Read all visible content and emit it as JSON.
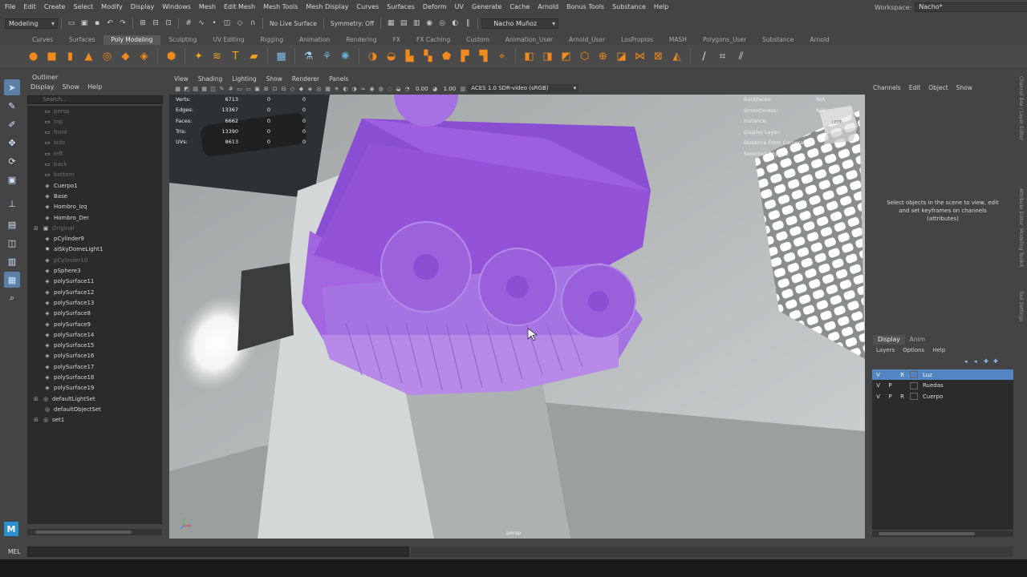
{
  "menubar": {
    "items": [
      "File",
      "Edit",
      "Create",
      "Select",
      "Modify",
      "Display",
      "Windows",
      "Mesh",
      "Edit Mesh",
      "Mesh Tools",
      "Mesh Display",
      "Curves",
      "Surfaces",
      "Deform",
      "UV",
      "Generate",
      "Cache",
      "Arnold",
      "Bonus Tools",
      "Substance",
      "Help"
    ],
    "workspace_label": "Workspace:",
    "workspace_value": "Nacho*"
  },
  "statusline": {
    "mode": "Modeling",
    "live_surface": "No Live Surface",
    "symmetry": "Symmetry: Off",
    "user": "Nacho Muñoz"
  },
  "shelf": {
    "tabs": [
      "Curves",
      "Surfaces",
      "Poly Modeling",
      "Sculpting",
      "UV Editing",
      "Rigging",
      "Animation",
      "Rendering",
      "FX",
      "FX Caching",
      "Custom",
      "Animation_User",
      "Arnold_User",
      "LosPropios",
      "MASH",
      "Polygons_User",
      "Substance",
      "Arnold"
    ],
    "active_tab": "Poly Modeling"
  },
  "outliner": {
    "title": "Outliner",
    "menu": [
      "Display",
      "Show",
      "Help"
    ],
    "search_placeholder": "Search...",
    "items": [
      {
        "label": "persp",
        "dim": true,
        "indent": 1,
        "icon": "camera"
      },
      {
        "label": "top",
        "dim": true,
        "indent": 1,
        "icon": "camera"
      },
      {
        "label": "front",
        "dim": true,
        "indent": 1,
        "icon": "camera"
      },
      {
        "label": "side",
        "dim": true,
        "indent": 1,
        "icon": "camera"
      },
      {
        "label": "left",
        "dim": true,
        "indent": 1,
        "icon": "camera"
      },
      {
        "label": "back",
        "dim": true,
        "indent": 1,
        "icon": "camera"
      },
      {
        "label": "bottom",
        "dim": true,
        "indent": 1,
        "icon": "camera"
      },
      {
        "label": "Cuerpo1",
        "dim": false,
        "indent": 1,
        "icon": "mesh"
      },
      {
        "label": "Base",
        "dim": false,
        "indent": 1,
        "icon": "mesh"
      },
      {
        "label": "Hombro_Izq",
        "dim": false,
        "indent": 1,
        "icon": "mesh"
      },
      {
        "label": "Hombro_Der",
        "dim": false,
        "indent": 1,
        "icon": "mesh"
      },
      {
        "label": "Original",
        "dim": true,
        "indent": 0,
        "icon": "group"
      },
      {
        "label": "pCylinder9",
        "dim": false,
        "indent": 1,
        "icon": "mesh"
      },
      {
        "label": "aiSkyDomeLight1",
        "dim": false,
        "indent": 1,
        "icon": "light"
      },
      {
        "label": "pCylinder10",
        "dim": true,
        "indent": 1,
        "icon": "mesh"
      },
      {
        "label": "pSphere3",
        "dim": false,
        "indent": 1,
        "icon": "mesh"
      },
      {
        "label": "polySurface11",
        "dim": false,
        "indent": 1,
        "icon": "mesh"
      },
      {
        "label": "polySurface12",
        "dim": false,
        "indent": 1,
        "icon": "mesh"
      },
      {
        "label": "polySurface13",
        "dim": false,
        "indent": 1,
        "icon": "mesh"
      },
      {
        "label": "polySurface8",
        "dim": false,
        "indent": 1,
        "icon": "mesh"
      },
      {
        "label": "polySurface9",
        "dim": false,
        "indent": 1,
        "icon": "mesh"
      },
      {
        "label": "polySurface14",
        "dim": false,
        "indent": 1,
        "icon": "mesh"
      },
      {
        "label": "polySurface15",
        "dim": false,
        "indent": 1,
        "icon": "mesh"
      },
      {
        "label": "polySurface16",
        "dim": false,
        "indent": 1,
        "icon": "mesh"
      },
      {
        "label": "polySurface17",
        "dim": false,
        "indent": 1,
        "icon": "mesh"
      },
      {
        "label": "polySurface18",
        "dim": false,
        "indent": 1,
        "icon": "mesh"
      },
      {
        "label": "polySurface19",
        "dim": false,
        "indent": 1,
        "icon": "mesh"
      },
      {
        "label": "defaultLightSet",
        "dim": false,
        "indent": 0,
        "icon": "set"
      },
      {
        "label": "defaultObjectSet",
        "dim": false,
        "indent": 1,
        "icon": "set"
      },
      {
        "label": "set1",
        "dim": false,
        "indent": 0,
        "icon": "set"
      }
    ]
  },
  "viewport": {
    "menus": [
      "View",
      "Shading",
      "Lighting",
      "Show",
      "Renderer",
      "Panels"
    ],
    "exposure": "0.00",
    "gamma": "1.00",
    "color_management": "ACES 1.0 SDR-video (sRGB)",
    "hud_left": [
      {
        "label": "Verts:",
        "v1": "6713",
        "v2": "0",
        "v3": "0"
      },
      {
        "label": "Edges:",
        "v1": "13367",
        "v2": "0",
        "v3": "0"
      },
      {
        "label": "Faces:",
        "v1": "6662",
        "v2": "0",
        "v3": "0"
      },
      {
        "label": "Tris:",
        "v1": "13390",
        "v2": "0",
        "v3": "0"
      },
      {
        "label": "UVs:",
        "v1": "8613",
        "v2": "0",
        "v3": "0"
      }
    ],
    "hud_right": [
      {
        "label": "Backfaces:",
        "value": "N/A"
      },
      {
        "label": "Smoothness:",
        "value": "N/A"
      },
      {
        "label": "Instance:",
        "value": ""
      },
      {
        "label": "Display Layer:",
        "value": ""
      },
      {
        "label": "Distance From Camera:",
        "value": ""
      },
      {
        "label": "Selected Objects:",
        "value": ""
      }
    ],
    "viewcube_label": "LEFT",
    "camera": "persp",
    "mesh_color": "#9a52d8"
  },
  "channel_box": {
    "menu": [
      "Channels",
      "Edit",
      "Object",
      "Show"
    ],
    "info": "Select objects in the scene to view, edit and set keyframes on channels (attributes)"
  },
  "layer_editor": {
    "tabs": [
      "Display",
      "Anim"
    ],
    "active_tab": "Display",
    "menu": [
      "Layers",
      "Options",
      "Help"
    ],
    "layers": [
      {
        "v": "V",
        "p": "",
        "r": "R",
        "name": "Luz",
        "selected": true
      },
      {
        "v": "V",
        "p": "P",
        "r": "",
        "name": "Ruedas",
        "selected": false
      },
      {
        "v": "V",
        "p": "P",
        "r": "R",
        "name": "Cuerpo",
        "selected": false
      }
    ]
  },
  "side_tabs": [
    "Channel Box / Layer Editor",
    "Attribute Editor",
    "Modeling Toolkit",
    "Tool Settings"
  ],
  "command_line": {
    "label": "MEL"
  },
  "maya_logo": "M",
  "colors": {
    "accent": "#5285c1",
    "background": "#444444",
    "mesh": "#9a52d8"
  }
}
